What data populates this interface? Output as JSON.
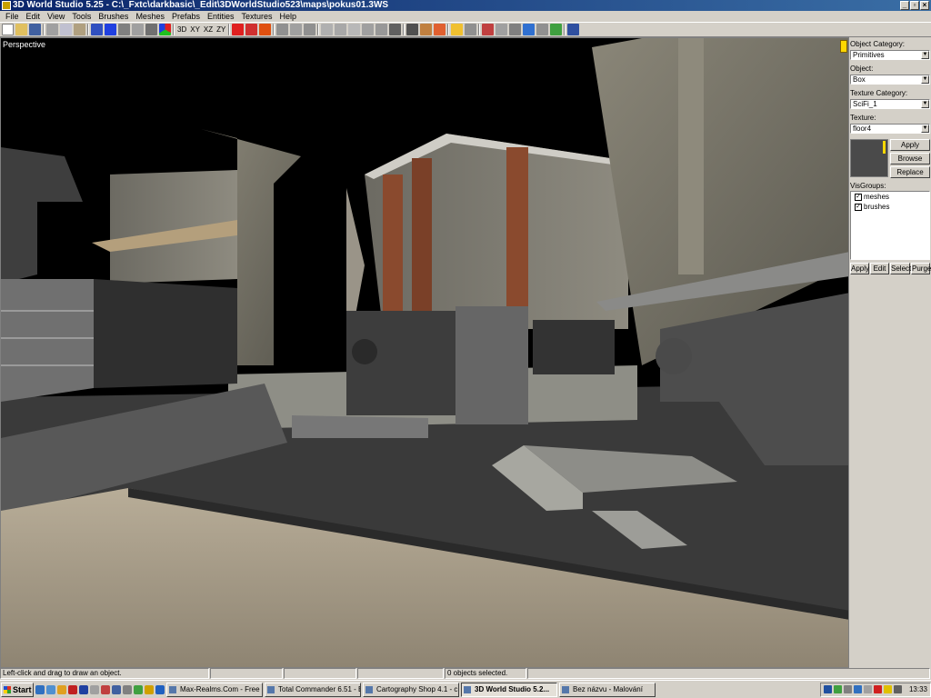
{
  "window": {
    "title": "3D World Studio 5.25 - C:\\_Fxtc\\darkbasic\\_Edit\\3DWorldStudio523\\maps\\pokus01.3WS",
    "controls": [
      "_",
      "▫",
      "×"
    ]
  },
  "menu": [
    "File",
    "Edit",
    "View",
    "Tools",
    "Brushes",
    "Meshes",
    "Prefabs",
    "Entities",
    "Textures",
    "Help"
  ],
  "toolbar": {
    "view_buttons": [
      "3D",
      "XY",
      "XZ",
      "ZY"
    ]
  },
  "viewport": {
    "label": "Perspective"
  },
  "panel": {
    "object_category_label": "Object Category:",
    "object_category_value": "Primitives",
    "object_label": "Object:",
    "object_value": "Box",
    "texture_category_label": "Texture Category:",
    "texture_category_value": "SciFi_1",
    "texture_label": "Texture:",
    "texture_value": "floor4",
    "apply_label": "Apply",
    "browse_label": "Browse",
    "replace_label": "Replace",
    "visgroups_label": "VisGroups:",
    "visgroups": [
      {
        "name": "meshes",
        "checked": true
      },
      {
        "name": "brushes",
        "checked": true
      }
    ],
    "vis_buttons": [
      "Apply",
      "Edit",
      "Select",
      "Purge"
    ]
  },
  "status": {
    "hint": "Left-click and drag to draw an object.",
    "selection": "0 objects selected."
  },
  "taskbar": {
    "start_label": "Start",
    "tasks": [
      {
        "label": "Max-Realms.Com - Free 3...",
        "active": false
      },
      {
        "label": "Total Commander 6.51 - B...",
        "active": false
      },
      {
        "label": "Cartography Shop 4.1 - c...",
        "active": false
      },
      {
        "label": "3D World Studio 5.2...",
        "active": true
      },
      {
        "label": "Bez názvu - Malování",
        "active": false
      }
    ],
    "clock": "13:33"
  }
}
